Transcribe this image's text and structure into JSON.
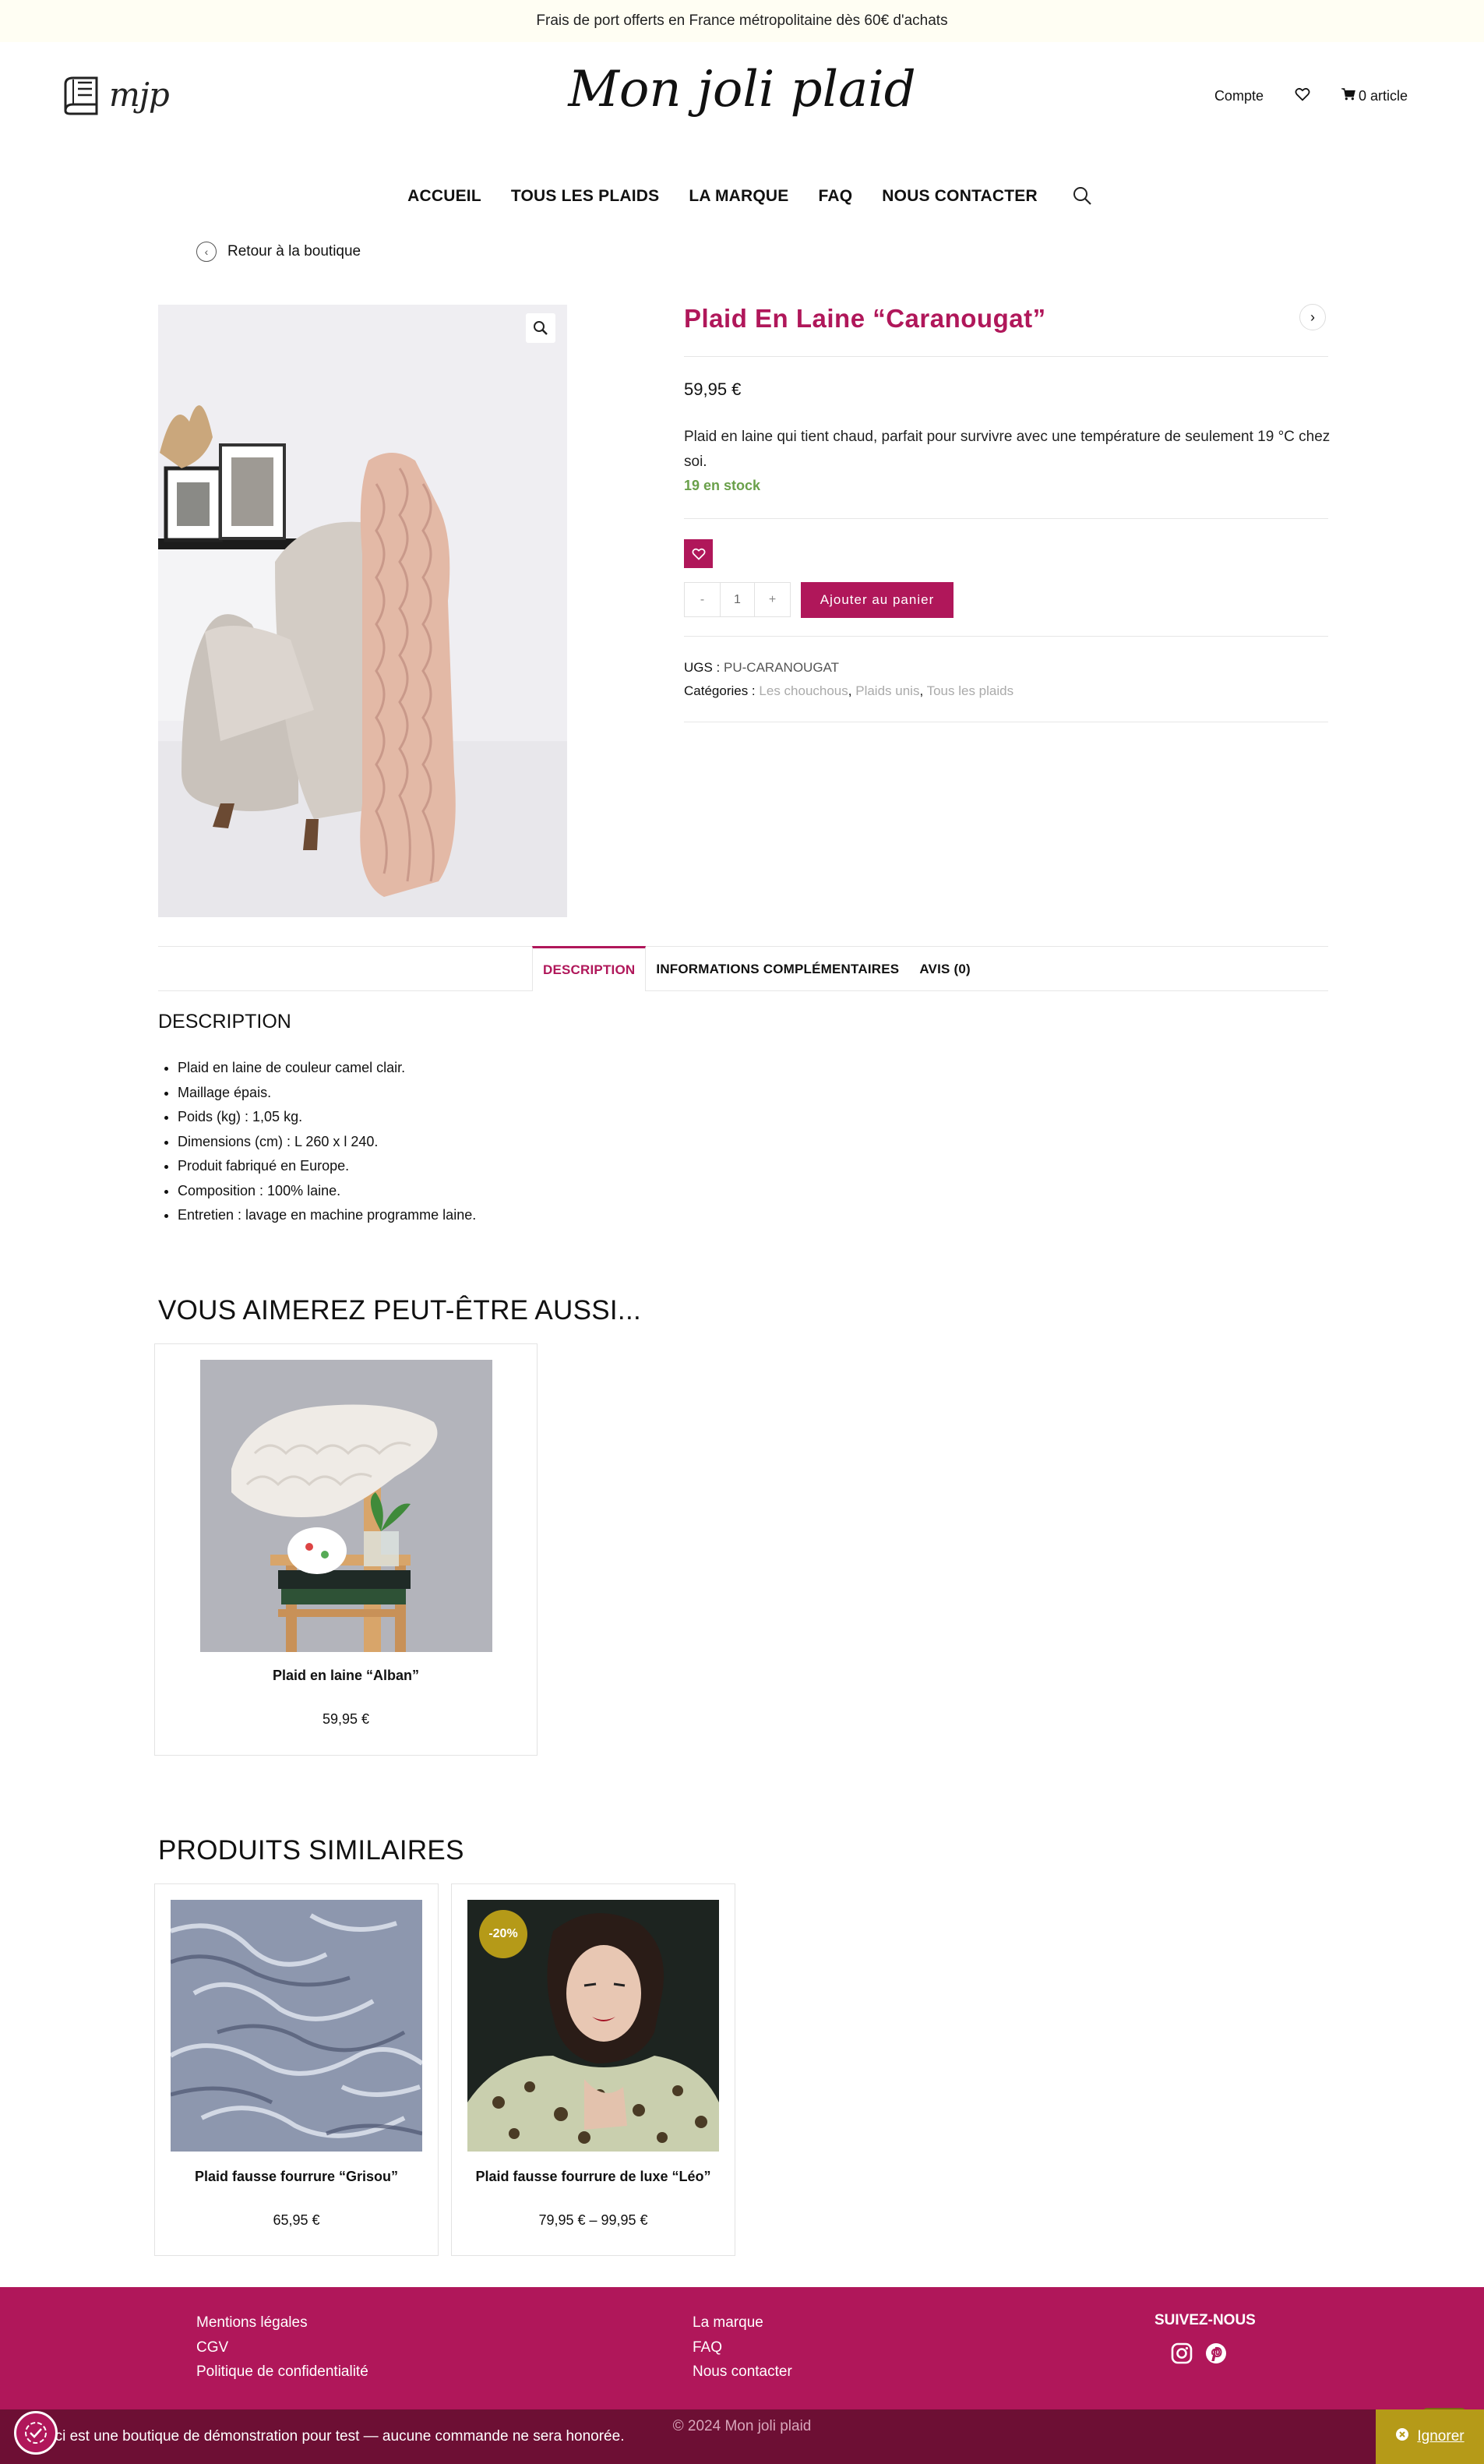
{
  "topbar": {
    "text": "Frais de port offerts en France métropolitaine dès 60€ d'achats"
  },
  "header": {
    "logo_small": "mjp",
    "logo_main": "Mon joli plaid",
    "account": "Compte",
    "cart": "0 article"
  },
  "nav": {
    "items": [
      "ACCUEIL",
      "TOUS LES PLAIDS",
      "LA MARQUE",
      "FAQ",
      "NOUS CONTACTER"
    ]
  },
  "back_link": "Retour à la boutique",
  "product": {
    "title": "Plaid En Laine “Caranougat”",
    "price": "59,95 €",
    "short_description": "Plaid en laine qui tient chaud, parfait pour survivre avec une température de seulement 19 °C chez soi.",
    "stock": "19 en stock",
    "qty_minus": "-",
    "qty_value": "1",
    "qty_plus": "+",
    "add_to_cart": "Ajouter au panier",
    "sku_label": "UGS :",
    "sku_value": "PU-CARANOUGAT",
    "categories_label": "Catégories :",
    "categories": [
      "Les chouchous",
      "Plaids unis",
      "Tous les plaids"
    ],
    "sep": ", "
  },
  "tabs": [
    "DESCRIPTION",
    "INFORMATIONS COMPLÉMENTAIRES",
    "AVIS (0)"
  ],
  "description": {
    "heading": "DESCRIPTION",
    "items": [
      "Plaid en laine de couleur camel clair.",
      "Maillage épais.",
      "Poids (kg) : 1,05 kg.",
      "Dimensions (cm) : L 260 x l 240.",
      "Produit fabriqué en Europe.",
      "Composition : 100% laine.",
      "Entretien : lavage en machine programme laine."
    ]
  },
  "upsell": {
    "heading": "VOUS AIMEREZ PEUT-ÊTRE AUSSI...",
    "products": [
      {
        "title": "Plaid en laine “Alban”",
        "price": "59,95 €"
      }
    ]
  },
  "related": {
    "heading": "PRODUITS SIMILAIRES",
    "products": [
      {
        "title": "Plaid fausse fourrure “Grisou”",
        "price": "65,95 €"
      },
      {
        "title": "Plaid fausse fourrure de luxe “Léo”",
        "price": "79,95 € – 99,95 €",
        "badge": "-20%"
      }
    ]
  },
  "footer": {
    "col1": [
      "Mentions légales",
      "CGV",
      "Politique de confidentialité"
    ],
    "col2": [
      "La marque",
      "FAQ",
      "Nous contacter"
    ],
    "follow": "SUIVEZ-NOUS",
    "social_icons": [
      "instagram-icon",
      "pinterest-icon"
    ],
    "copyright": "© 2024 Mon joli plaid"
  },
  "store_notice": {
    "text": "eci est une boutique de démonstration pour test — aucune commande ne sera honorée.",
    "dismiss": "Ignorer"
  },
  "colors": {
    "accent": "#b0175a",
    "gold": "#b59a18",
    "stock": "#6aa04a",
    "footer_dark": "#6d0f34"
  }
}
